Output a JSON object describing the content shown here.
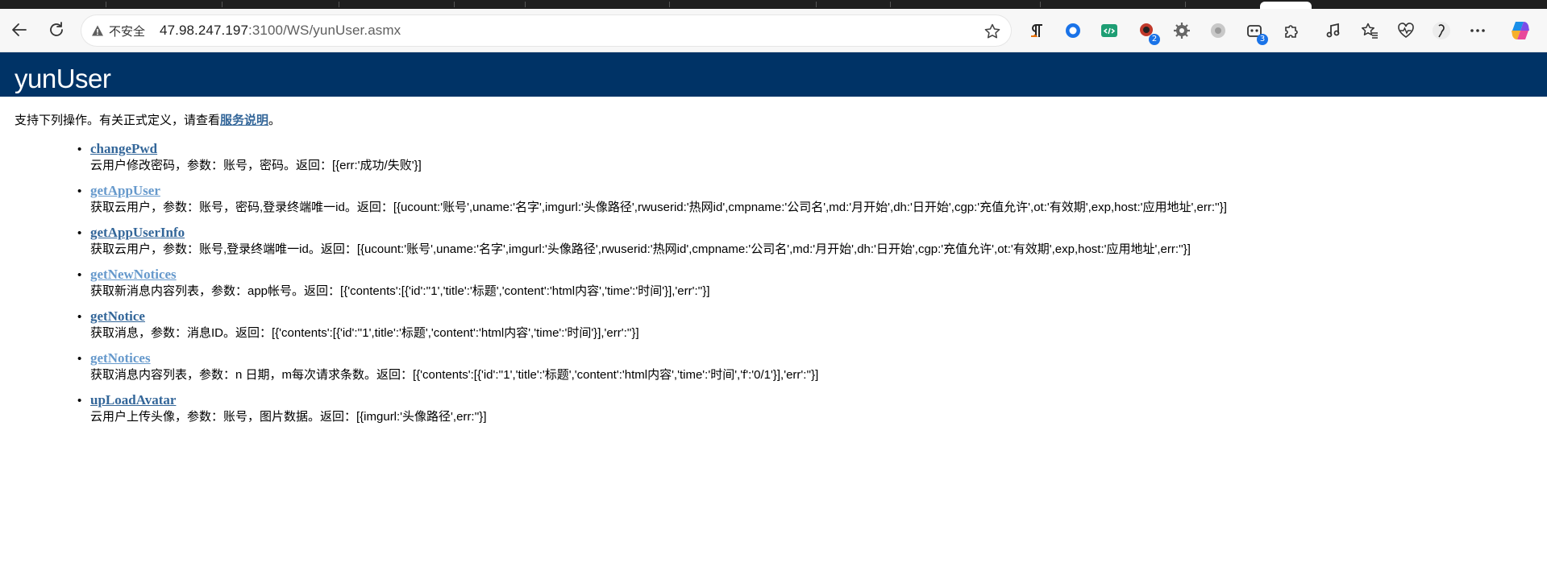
{
  "browser": {
    "security_label": "不安全",
    "url_host": "47.98.247.197",
    "url_rest": ":3100/WS/yunUser.asmx",
    "extension_badges": [
      "2",
      "3"
    ]
  },
  "page": {
    "title": "yunUser",
    "intro_text": "支持下列操作。有关正式定义，请查看",
    "intro_link": "服务说明",
    "intro_end": "。",
    "operations": [
      {
        "name": "changePwd",
        "desc": "云用户修改密码，参数：账号，密码。返回：[{err:'成功/失败'}]",
        "visited": false
      },
      {
        "name": "getAppUser",
        "desc": "获取云用户，参数：账号，密码,登录终端唯一id。返回：[{ucount:'账号',uname:'名字',imgurl:'头像路径',rwuserid:'热网id',cmpname:'公司名',md:'月开始',dh:'日开始',cgp:'充值允许',ot:'有效期',exp,host:'应用地址',err:''}]",
        "visited": true
      },
      {
        "name": "getAppUserInfo",
        "desc": "获取云用户，参数：账号,登录终端唯一id。返回：[{ucount:'账号',uname:'名字',imgurl:'头像路径',rwuserid:'热网id',cmpname:'公司名',md:'月开始',dh:'日开始',cgp:'充值允许',ot:'有效期',exp,host:'应用地址',err:''}]",
        "visited": false
      },
      {
        "name": "getNewNotices",
        "desc": "获取新消息内容列表，参数：app帐号。返回：[{'contents':[{'id':''1','title':'标题','content':'html内容','time':'时间'}],'err':''}]",
        "visited": true
      },
      {
        "name": "getNotice",
        "desc": "获取消息，参数：消息ID。返回：[{'contents':[{'id':''1',title':'标题','content':'html内容','time':'时间'}],'err':''}]",
        "visited": false
      },
      {
        "name": "getNotices",
        "desc": "获取消息内容列表，参数：n 日期，m每次请求条数。返回：[{'contents':[{'id':''1','title':'标题','content':'html内容','time':'时间','f':'0/1'}],'err':''}]",
        "visited": true
      },
      {
        "name": "upLoadAvatar",
        "desc": "云用户上传头像，参数：账号，图片数据。返回：[{imgurl:'头像路径',err:''}]",
        "visited": false
      }
    ]
  }
}
